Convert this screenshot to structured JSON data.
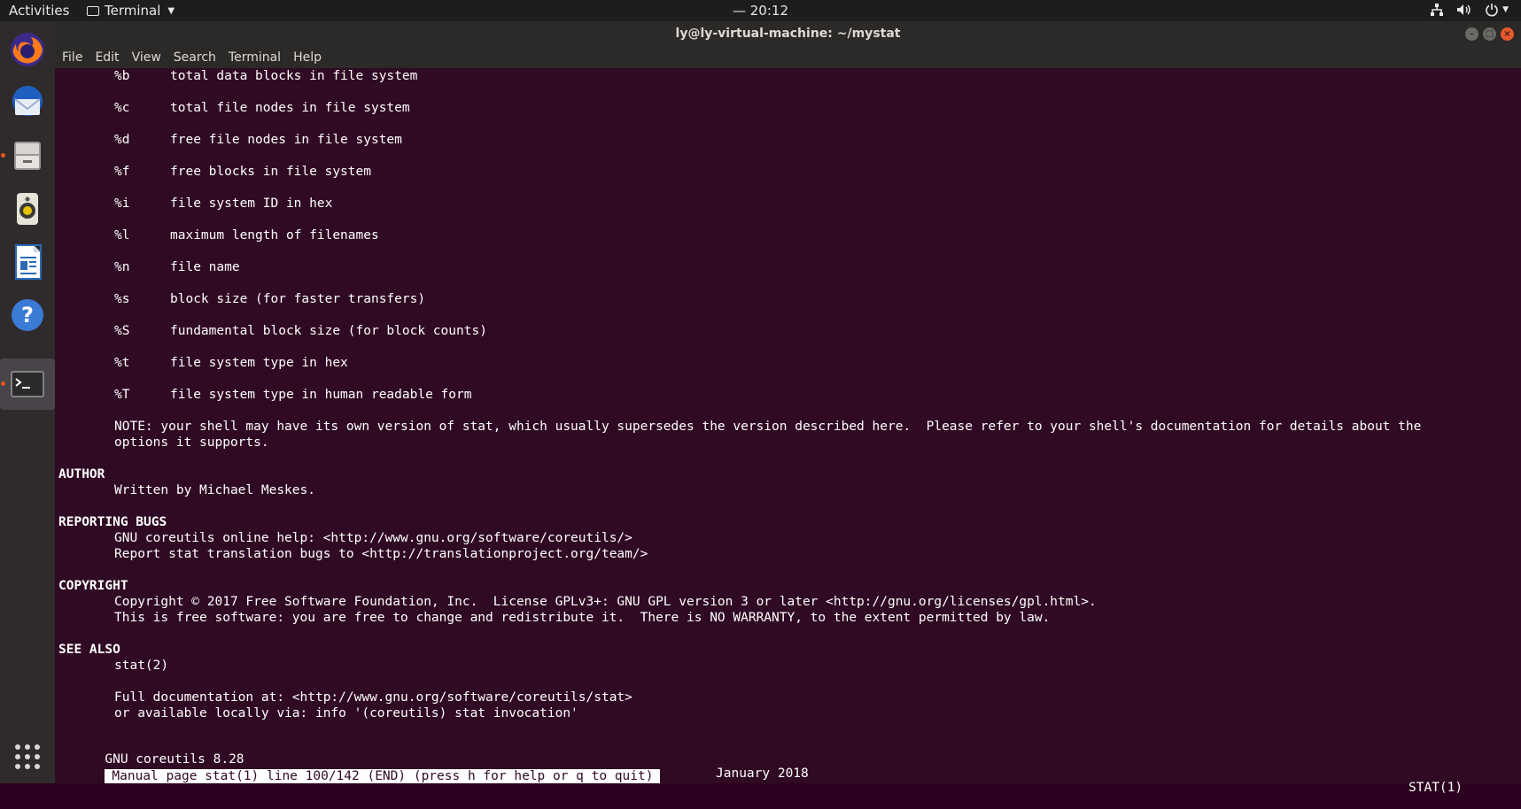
{
  "topbar": {
    "activities": "Activities",
    "app_name": "Terminal",
    "clock": "— 20:12"
  },
  "window": {
    "title": "ly@ly-virtual-machine: ~/mystat",
    "menu": [
      "File",
      "Edit",
      "View",
      "Search",
      "Terminal",
      "Help"
    ]
  },
  "dock": [
    "firefox-icon",
    "thunderbird-icon",
    "files-icon",
    "rhythmbox-icon",
    "libreoffice-writer-icon",
    "help-icon",
    "terminal-icon"
  ],
  "man": {
    "options": [
      {
        "flag": "%b",
        "desc": "total data blocks in file system"
      },
      {
        "flag": "%c",
        "desc": "total file nodes in file system"
      },
      {
        "flag": "%d",
        "desc": "free file nodes in file system"
      },
      {
        "flag": "%f",
        "desc": "free blocks in file system"
      },
      {
        "flag": "%i",
        "desc": "file system ID in hex"
      },
      {
        "flag": "%l",
        "desc": "maximum length of filenames"
      },
      {
        "flag": "%n",
        "desc": "file name"
      },
      {
        "flag": "%s",
        "desc": "block size (for faster transfers)"
      },
      {
        "flag": "%S",
        "desc": "fundamental block size (for block counts)"
      },
      {
        "flag": "%t",
        "desc": "file system type in hex"
      },
      {
        "flag": "%T",
        "desc": "file system type in human readable form"
      }
    ],
    "note1": "NOTE: your shell may have its own version of stat, which usually supersedes the version described here.  Please refer to your shell's documentation for details about the",
    "note2": "options it supports.",
    "author_h": "AUTHOR",
    "author": "Written by Michael Meskes.",
    "bugs_h": "REPORTING BUGS",
    "bugs1": "GNU coreutils online help: <http://www.gnu.org/software/coreutils/>",
    "bugs2": "Report stat translation bugs to <http://translationproject.org/team/>",
    "copy_h": "COPYRIGHT",
    "copy1": "Copyright © 2017 Free Software Foundation, Inc.  License GPLv3+: GNU GPL version 3 or later <http://gnu.org/licenses/gpl.html>.",
    "copy2": "This is free software: you are free to change and redistribute it.  There is NO WARRANTY, to the extent permitted by law.",
    "see_h": "SEE ALSO",
    "see1": "stat(2)",
    "see2": "Full documentation at: <http://www.gnu.org/software/coreutils/stat>",
    "see3": "or available locally via: info '(coreutils) stat invocation'",
    "footer_left": "GNU coreutils 8.28",
    "footer_center": "January 2018",
    "footer_right": "STAT(1)",
    "status": "Manual page stat(1) line 100/142 (END) (press h for help or q to quit)"
  }
}
